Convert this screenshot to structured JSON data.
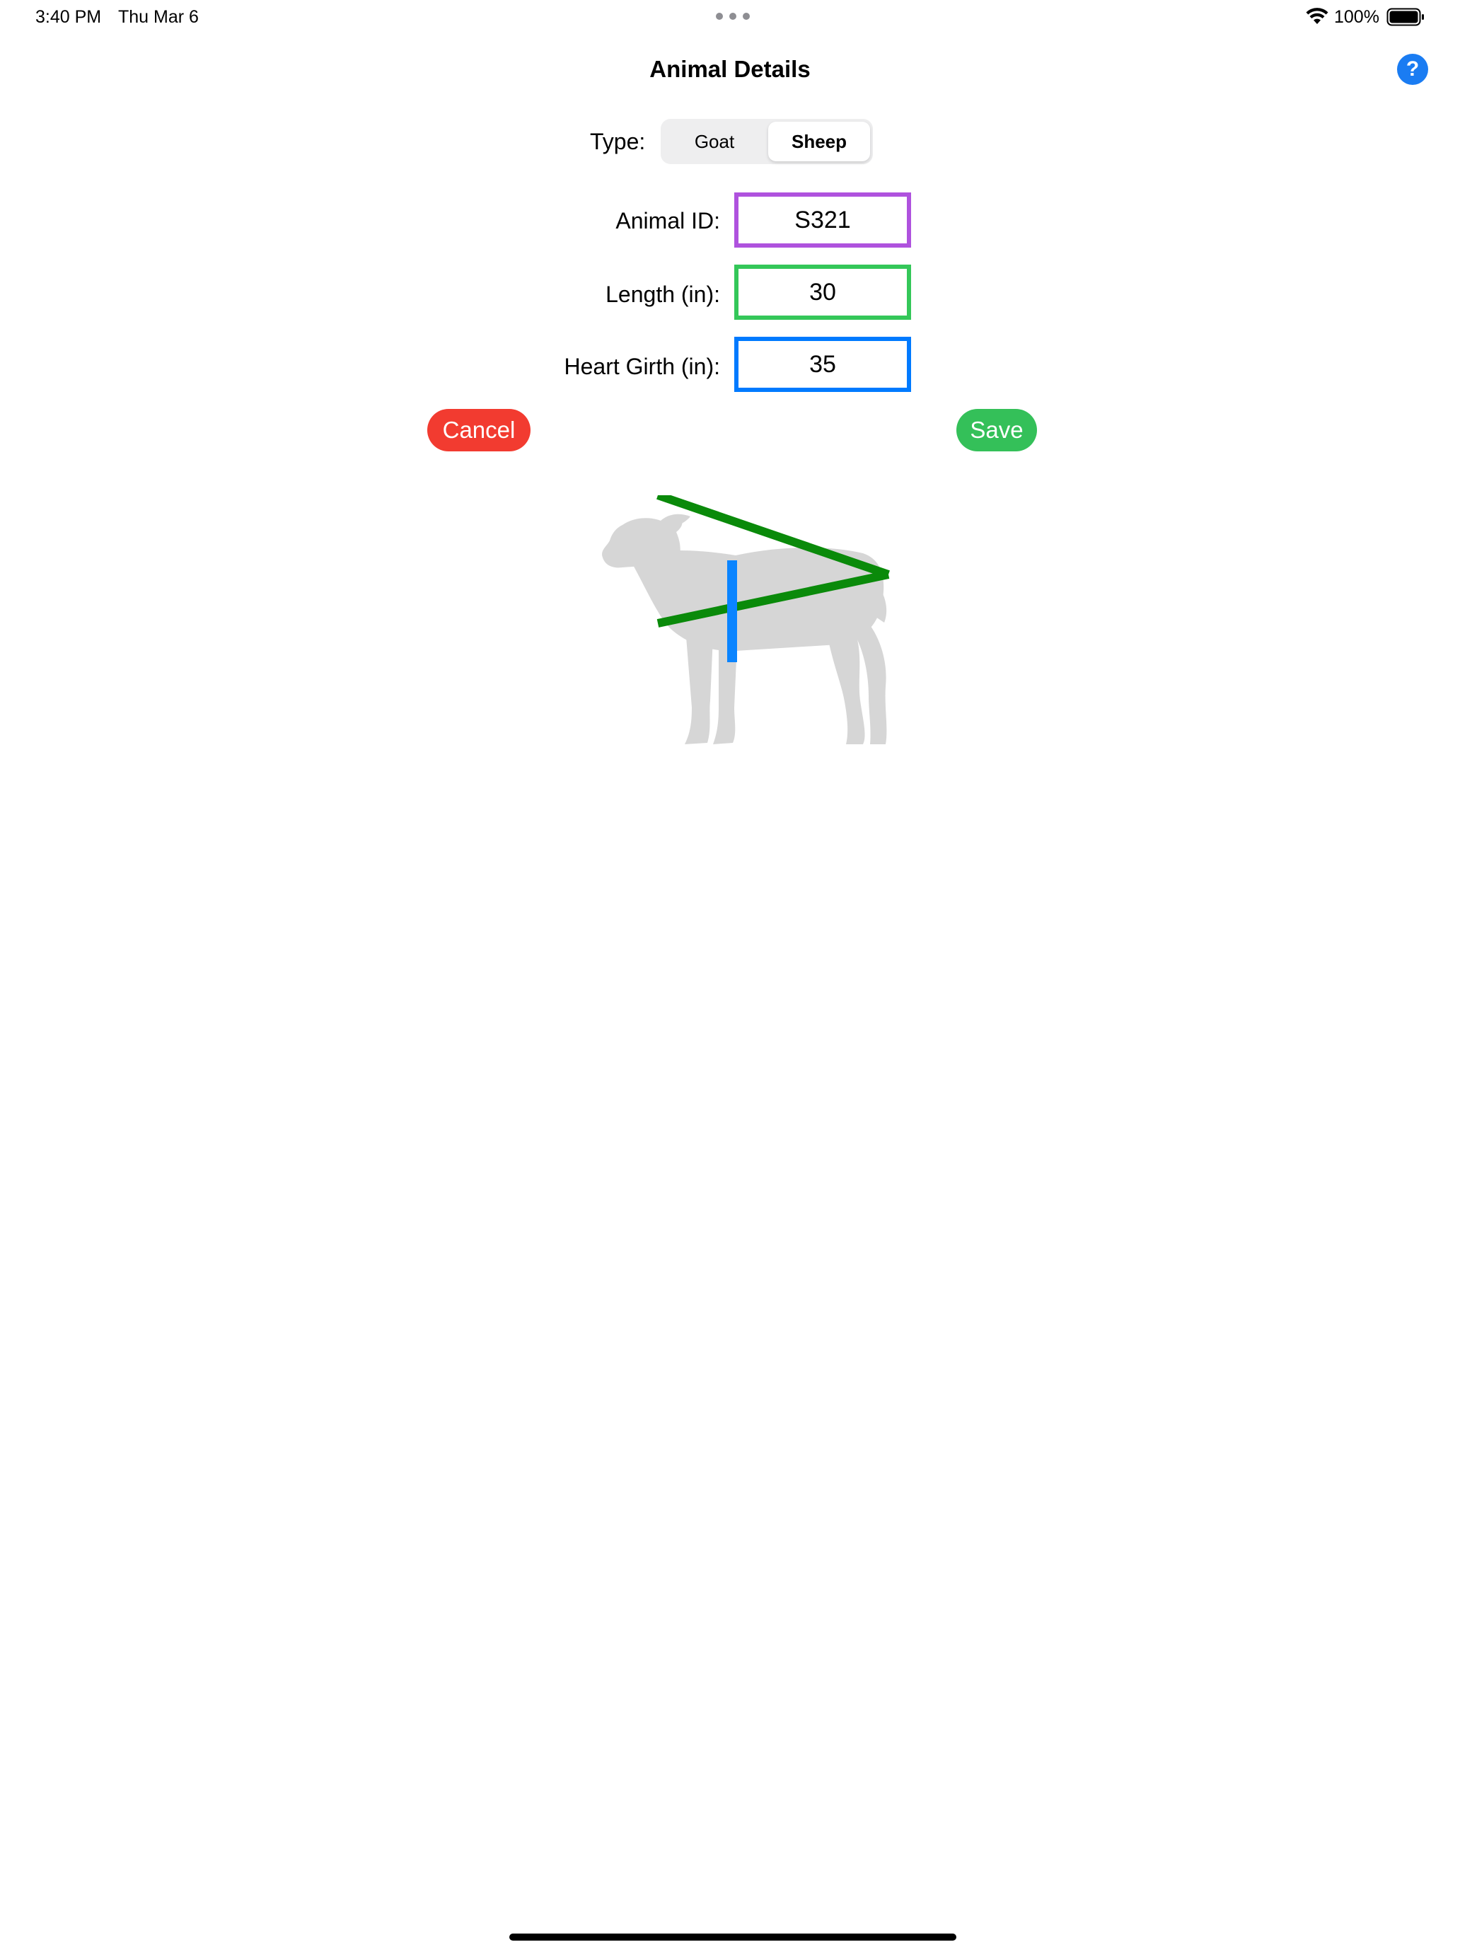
{
  "status_bar": {
    "time": "3:40 PM",
    "date": "Thu Mar 6",
    "battery": "100%"
  },
  "header": {
    "title": "Animal Details",
    "help_label": "?"
  },
  "type_selector": {
    "label": "Type:",
    "options": [
      "Goat",
      "Sheep"
    ],
    "selected": "Sheep"
  },
  "fields": {
    "animal_id": {
      "label": "Animal ID:",
      "value": "S321",
      "color": "#af52de"
    },
    "length": {
      "label": "Length (in):",
      "value": "30",
      "color": "#34c759"
    },
    "heart_girth": {
      "label": "Heart Girth (in):",
      "value": "35",
      "color": "#007aff"
    }
  },
  "actions": {
    "cancel_label": "Cancel",
    "cancel_color": "#f23b30",
    "save_label": "Save",
    "save_color": "#34c059"
  },
  "illustration": {
    "icon": "sheep-silhouette-icon",
    "length_line_color": "#0a8a0a",
    "girth_line_color": "#0a84ff"
  }
}
